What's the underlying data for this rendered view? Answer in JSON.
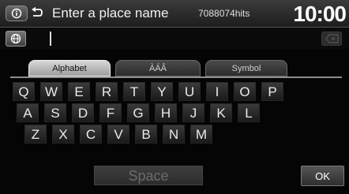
{
  "header": {
    "title": "Enter a place name",
    "hits": "7088074hits",
    "clock": "10:00"
  },
  "input": {
    "value": ""
  },
  "tabs": [
    {
      "label": "Alphabet",
      "selected": true
    },
    {
      "label": "ÀÁÂ",
      "selected": false
    },
    {
      "label": "Symbol",
      "selected": false
    }
  ],
  "keyboard": {
    "rows": [
      [
        "Q",
        "W",
        "E",
        "R",
        "T",
        "Y",
        "U",
        "I",
        "O",
        "P"
      ],
      [
        "A",
        "S",
        "D",
        "F",
        "G",
        "H",
        "J",
        "K",
        "L"
      ],
      [
        "Z",
        "X",
        "C",
        "V",
        "B",
        "N",
        "M"
      ]
    ]
  },
  "space_label": "Space",
  "ok_label": "OK",
  "icons": {
    "info": "info-icon",
    "back": "back-icon",
    "globe": "globe-icon",
    "delete": "delete-icon"
  },
  "colors": {
    "background": "#050505",
    "key": "#2a2a2a",
    "selected_tab": "#c9c9c9"
  }
}
